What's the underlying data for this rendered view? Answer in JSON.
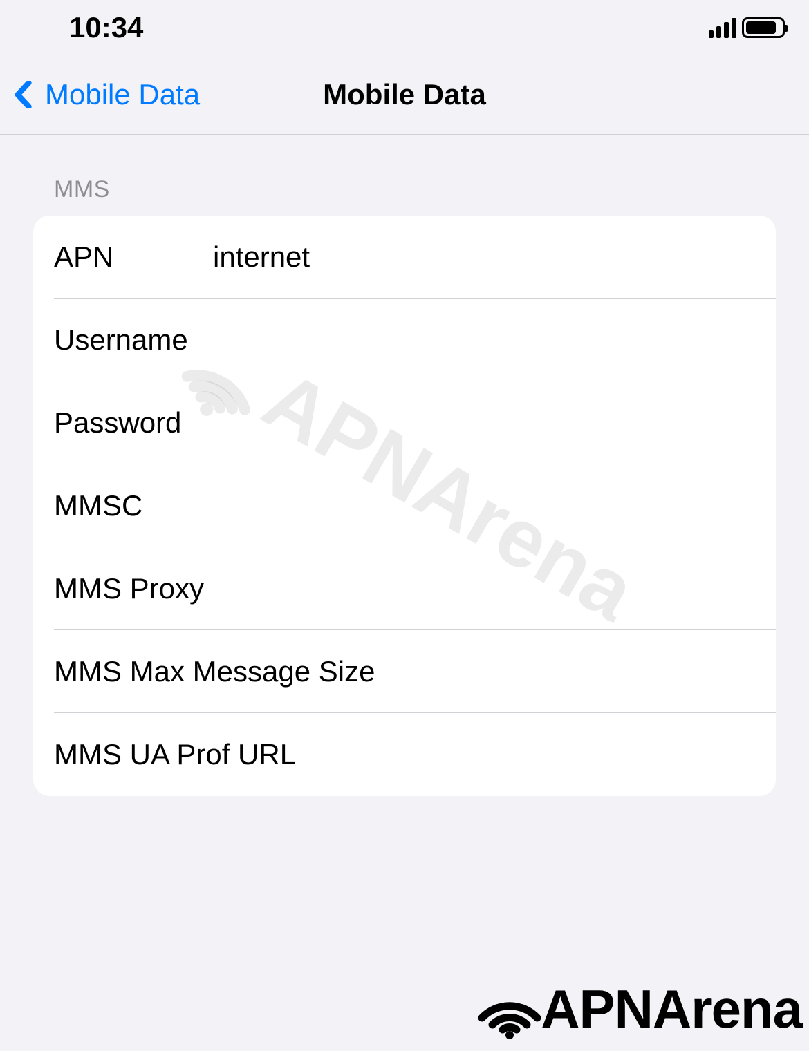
{
  "statusBar": {
    "time": "10:34"
  },
  "nav": {
    "backLabel": "Mobile Data",
    "title": "Mobile Data"
  },
  "section": {
    "header": "MMS",
    "rows": [
      {
        "label": "APN",
        "value": "internet"
      },
      {
        "label": "Username",
        "value": ""
      },
      {
        "label": "Password",
        "value": ""
      },
      {
        "label": "MMSC",
        "value": ""
      },
      {
        "label": "MMS Proxy",
        "value": ""
      },
      {
        "label": "MMS Max Message Size",
        "value": ""
      },
      {
        "label": "MMS UA Prof URL",
        "value": ""
      }
    ]
  },
  "brand": {
    "name": "APNArena"
  }
}
